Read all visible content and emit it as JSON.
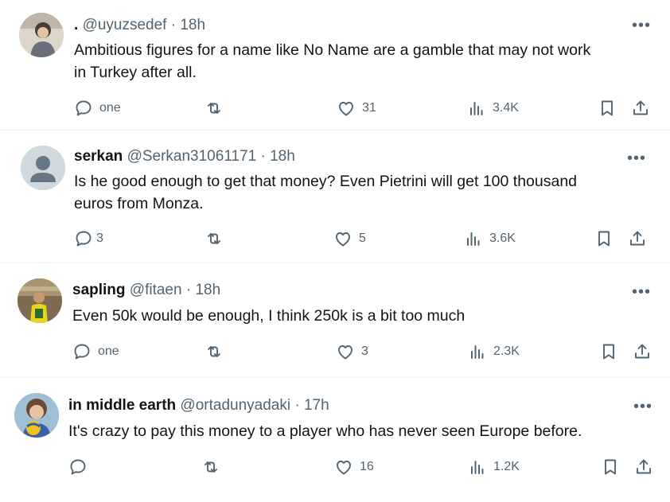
{
  "tweets": [
    {
      "name": ".",
      "handle": "@uyuzsedef",
      "time": "18h",
      "text_lines": [
        "Ambitious figures for a name like No Name are a gamble that may not work",
        "in Turkey after all."
      ],
      "replies": "one",
      "likes": "31",
      "views": "3.4K"
    },
    {
      "name": "serkan",
      "handle": "@Serkan31061171",
      "time": "18h",
      "text_lines": [
        "Is he good enough to get that money? Even Pietrini will get 100 thousand",
        "euros from Monza."
      ],
      "replies": "3",
      "likes": "5",
      "views": "3.6K"
    },
    {
      "name": "sapling",
      "handle": "@fitaen",
      "time": "18h",
      "text_lines": [
        "Even 50k would be enough, I think 250k is a bit too much"
      ],
      "replies": "one",
      "likes": "3",
      "views": "2.3K"
    },
    {
      "name": "in middle earth",
      "handle": "@ortadunyadaki",
      "time": "17h",
      "text_lines": [
        "It's crazy to pay this money to a player who has never seen Europe before."
      ],
      "replies": "",
      "likes": "16",
      "views": "1.2K"
    }
  ],
  "separator": "·",
  "more_label": "•••",
  "colors": {
    "text": "#0f1419",
    "secondary": "#536471",
    "divider": "#eff3f4"
  },
  "icons": [
    "reply-icon",
    "retweet-icon",
    "like-icon",
    "views-icon",
    "bookmark-icon",
    "share-icon",
    "more-icon"
  ]
}
